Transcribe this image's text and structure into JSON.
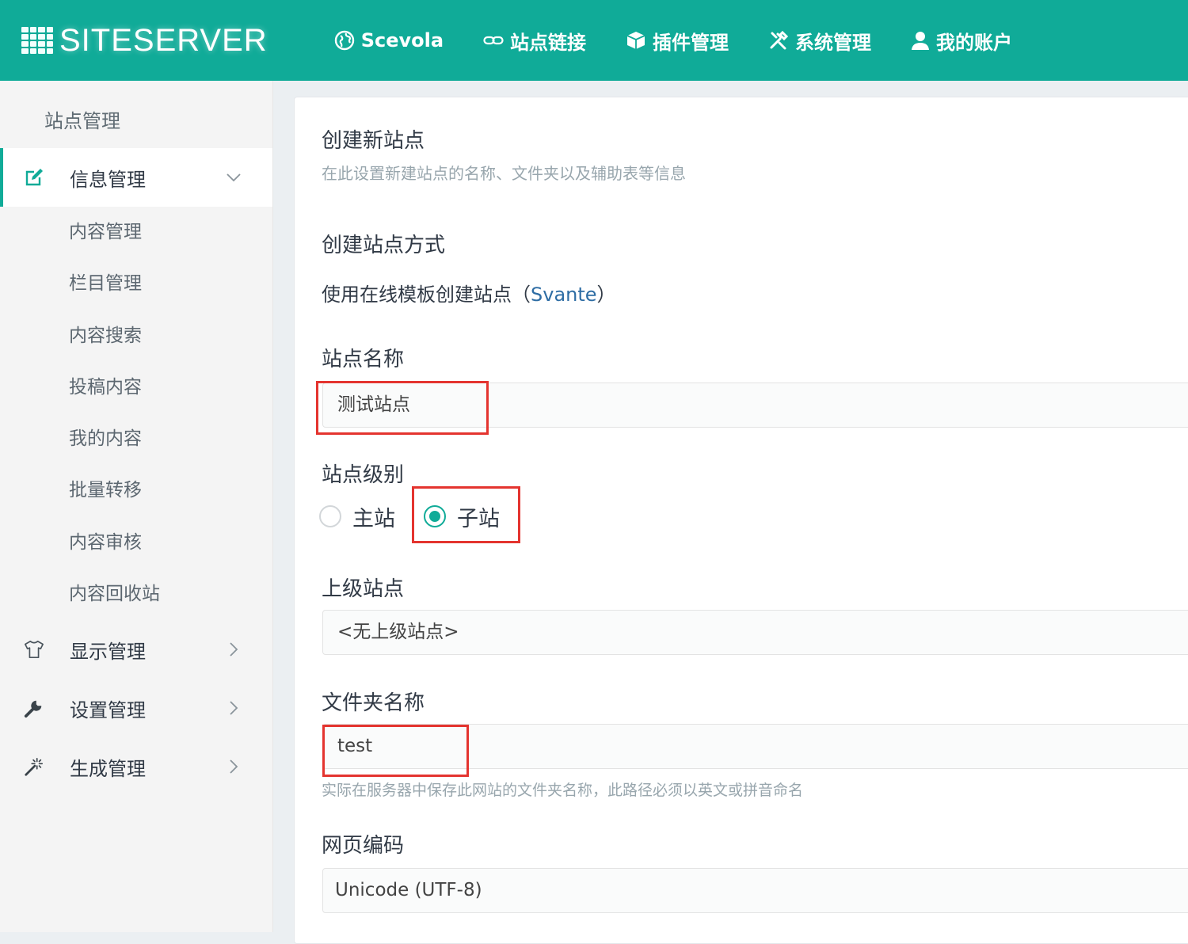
{
  "brand": {
    "name": "SITESERVER"
  },
  "topnav": [
    {
      "label": "Scevola",
      "icon": "globe-icon"
    },
    {
      "label": "站点链接",
      "icon": "link-icon"
    },
    {
      "label": "插件管理",
      "icon": "cube-icon"
    },
    {
      "label": "系统管理",
      "icon": "tools-icon"
    },
    {
      "label": "我的账户",
      "icon": "user-icon"
    }
  ],
  "sidebar": {
    "title": "站点管理",
    "menus": [
      {
        "label": "信息管理",
        "icon": "edit-icon",
        "expanded": true
      },
      {
        "label": "显示管理",
        "icon": "tshirt-icon",
        "expanded": false
      },
      {
        "label": "设置管理",
        "icon": "wrench-icon",
        "expanded": false
      },
      {
        "label": "生成管理",
        "icon": "magic-wand-icon",
        "expanded": false
      }
    ],
    "submenu": [
      {
        "label": "内容管理"
      },
      {
        "label": "栏目管理"
      },
      {
        "label": "内容搜索"
      },
      {
        "label": "投稿内容"
      },
      {
        "label": "我的内容"
      },
      {
        "label": "批量转移"
      },
      {
        "label": "内容审核"
      },
      {
        "label": "内容回收站"
      }
    ]
  },
  "form": {
    "title": "创建新站点",
    "description": "在此设置新建站点的名称、文件夹以及辅助表等信息",
    "method_label": "创建站点方式",
    "method_text": "使用在线模板创建站点（",
    "method_template": "Svante",
    "method_text_end": "）",
    "site_name_label": "站点名称",
    "site_name_value": "测试站点",
    "site_level_label": "站点级别",
    "site_level_options": [
      {
        "label": "主站",
        "checked": false
      },
      {
        "label": "子站",
        "checked": true
      }
    ],
    "parent_site_label": "上级站点",
    "parent_site_value": "<无上级站点>",
    "folder_label": "文件夹名称",
    "folder_value": "test",
    "folder_hint": "实际在服务器中保存此网站的文件夹名称，此路径必须以英文或拼音命名",
    "charset_label": "网页编码",
    "charset_value": "Unicode (UTF-8)"
  },
  "colors": {
    "brand": "#10ab98",
    "highlight": "#e4342f",
    "link": "#2e6da4"
  }
}
